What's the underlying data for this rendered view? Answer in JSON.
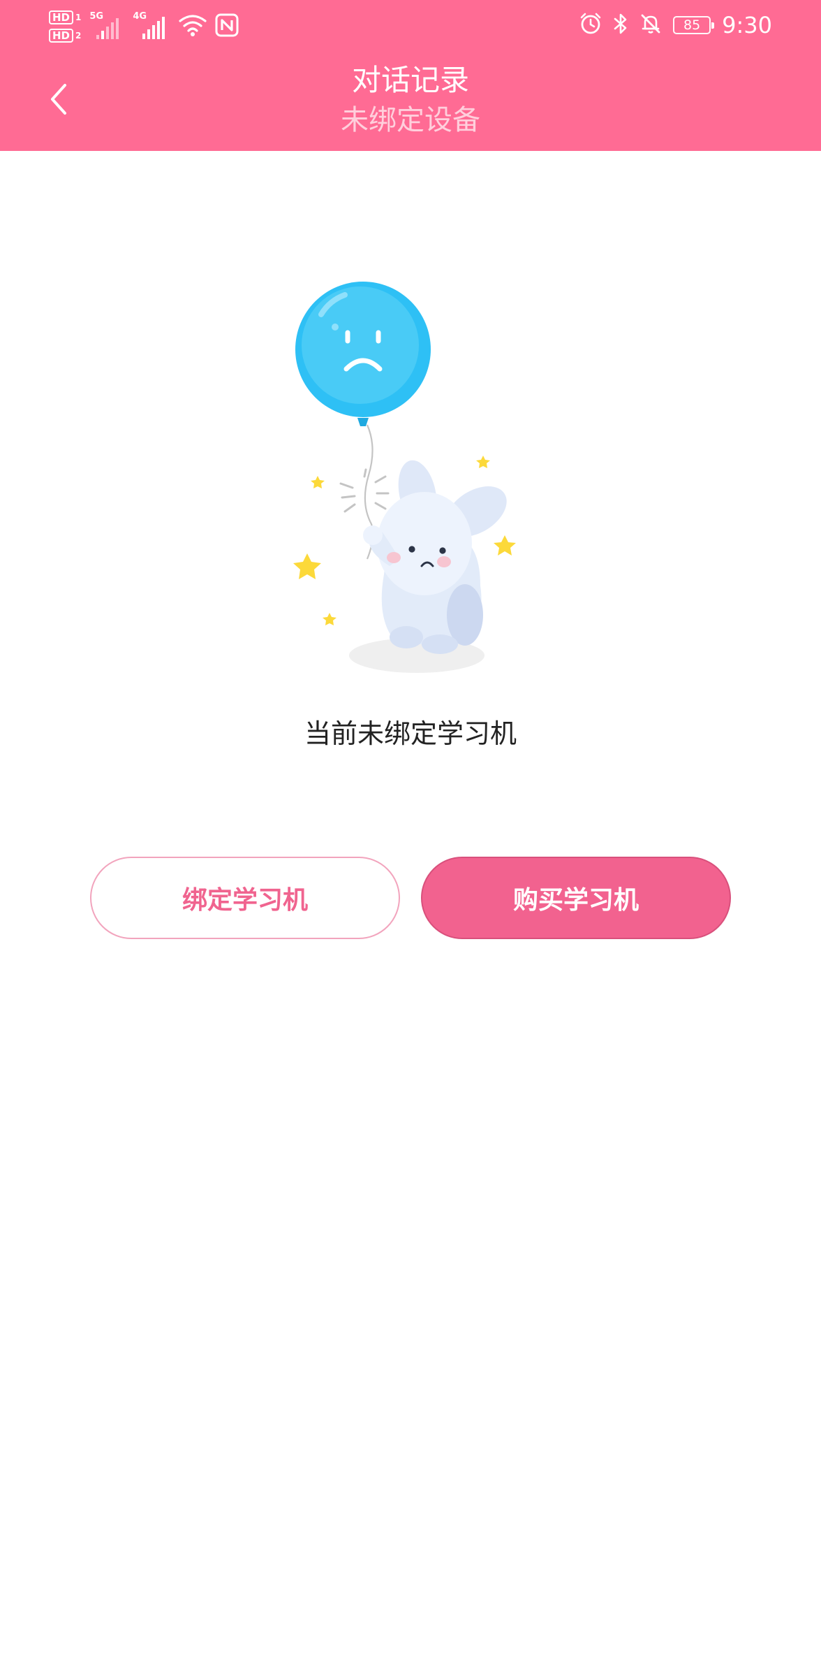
{
  "status_bar": {
    "hd1": "HD",
    "hd1_sub": "1",
    "hd2": "HD",
    "hd2_sub": "2",
    "net1": "5G",
    "net2": "4G",
    "battery": "85",
    "time": "9:30",
    "icons": [
      "signal-icon",
      "wifi-icon",
      "nfc-icon",
      "alarm-icon",
      "bluetooth-icon",
      "mute-bell-icon",
      "battery-icon"
    ]
  },
  "header": {
    "title": "对话记录",
    "subtitle": "未绑定设备",
    "back_icon": "chevron-left-icon"
  },
  "main": {
    "illustration_icon": "sad-bunny-balloon-illustration",
    "empty_message": "当前未绑定学习机"
  },
  "actions": {
    "bind_label": "绑定学习机",
    "buy_label": "购买学习机"
  },
  "colors": {
    "header": "#ff6b94",
    "accent": "#f2628f",
    "balloon": "#2ec0f5"
  }
}
